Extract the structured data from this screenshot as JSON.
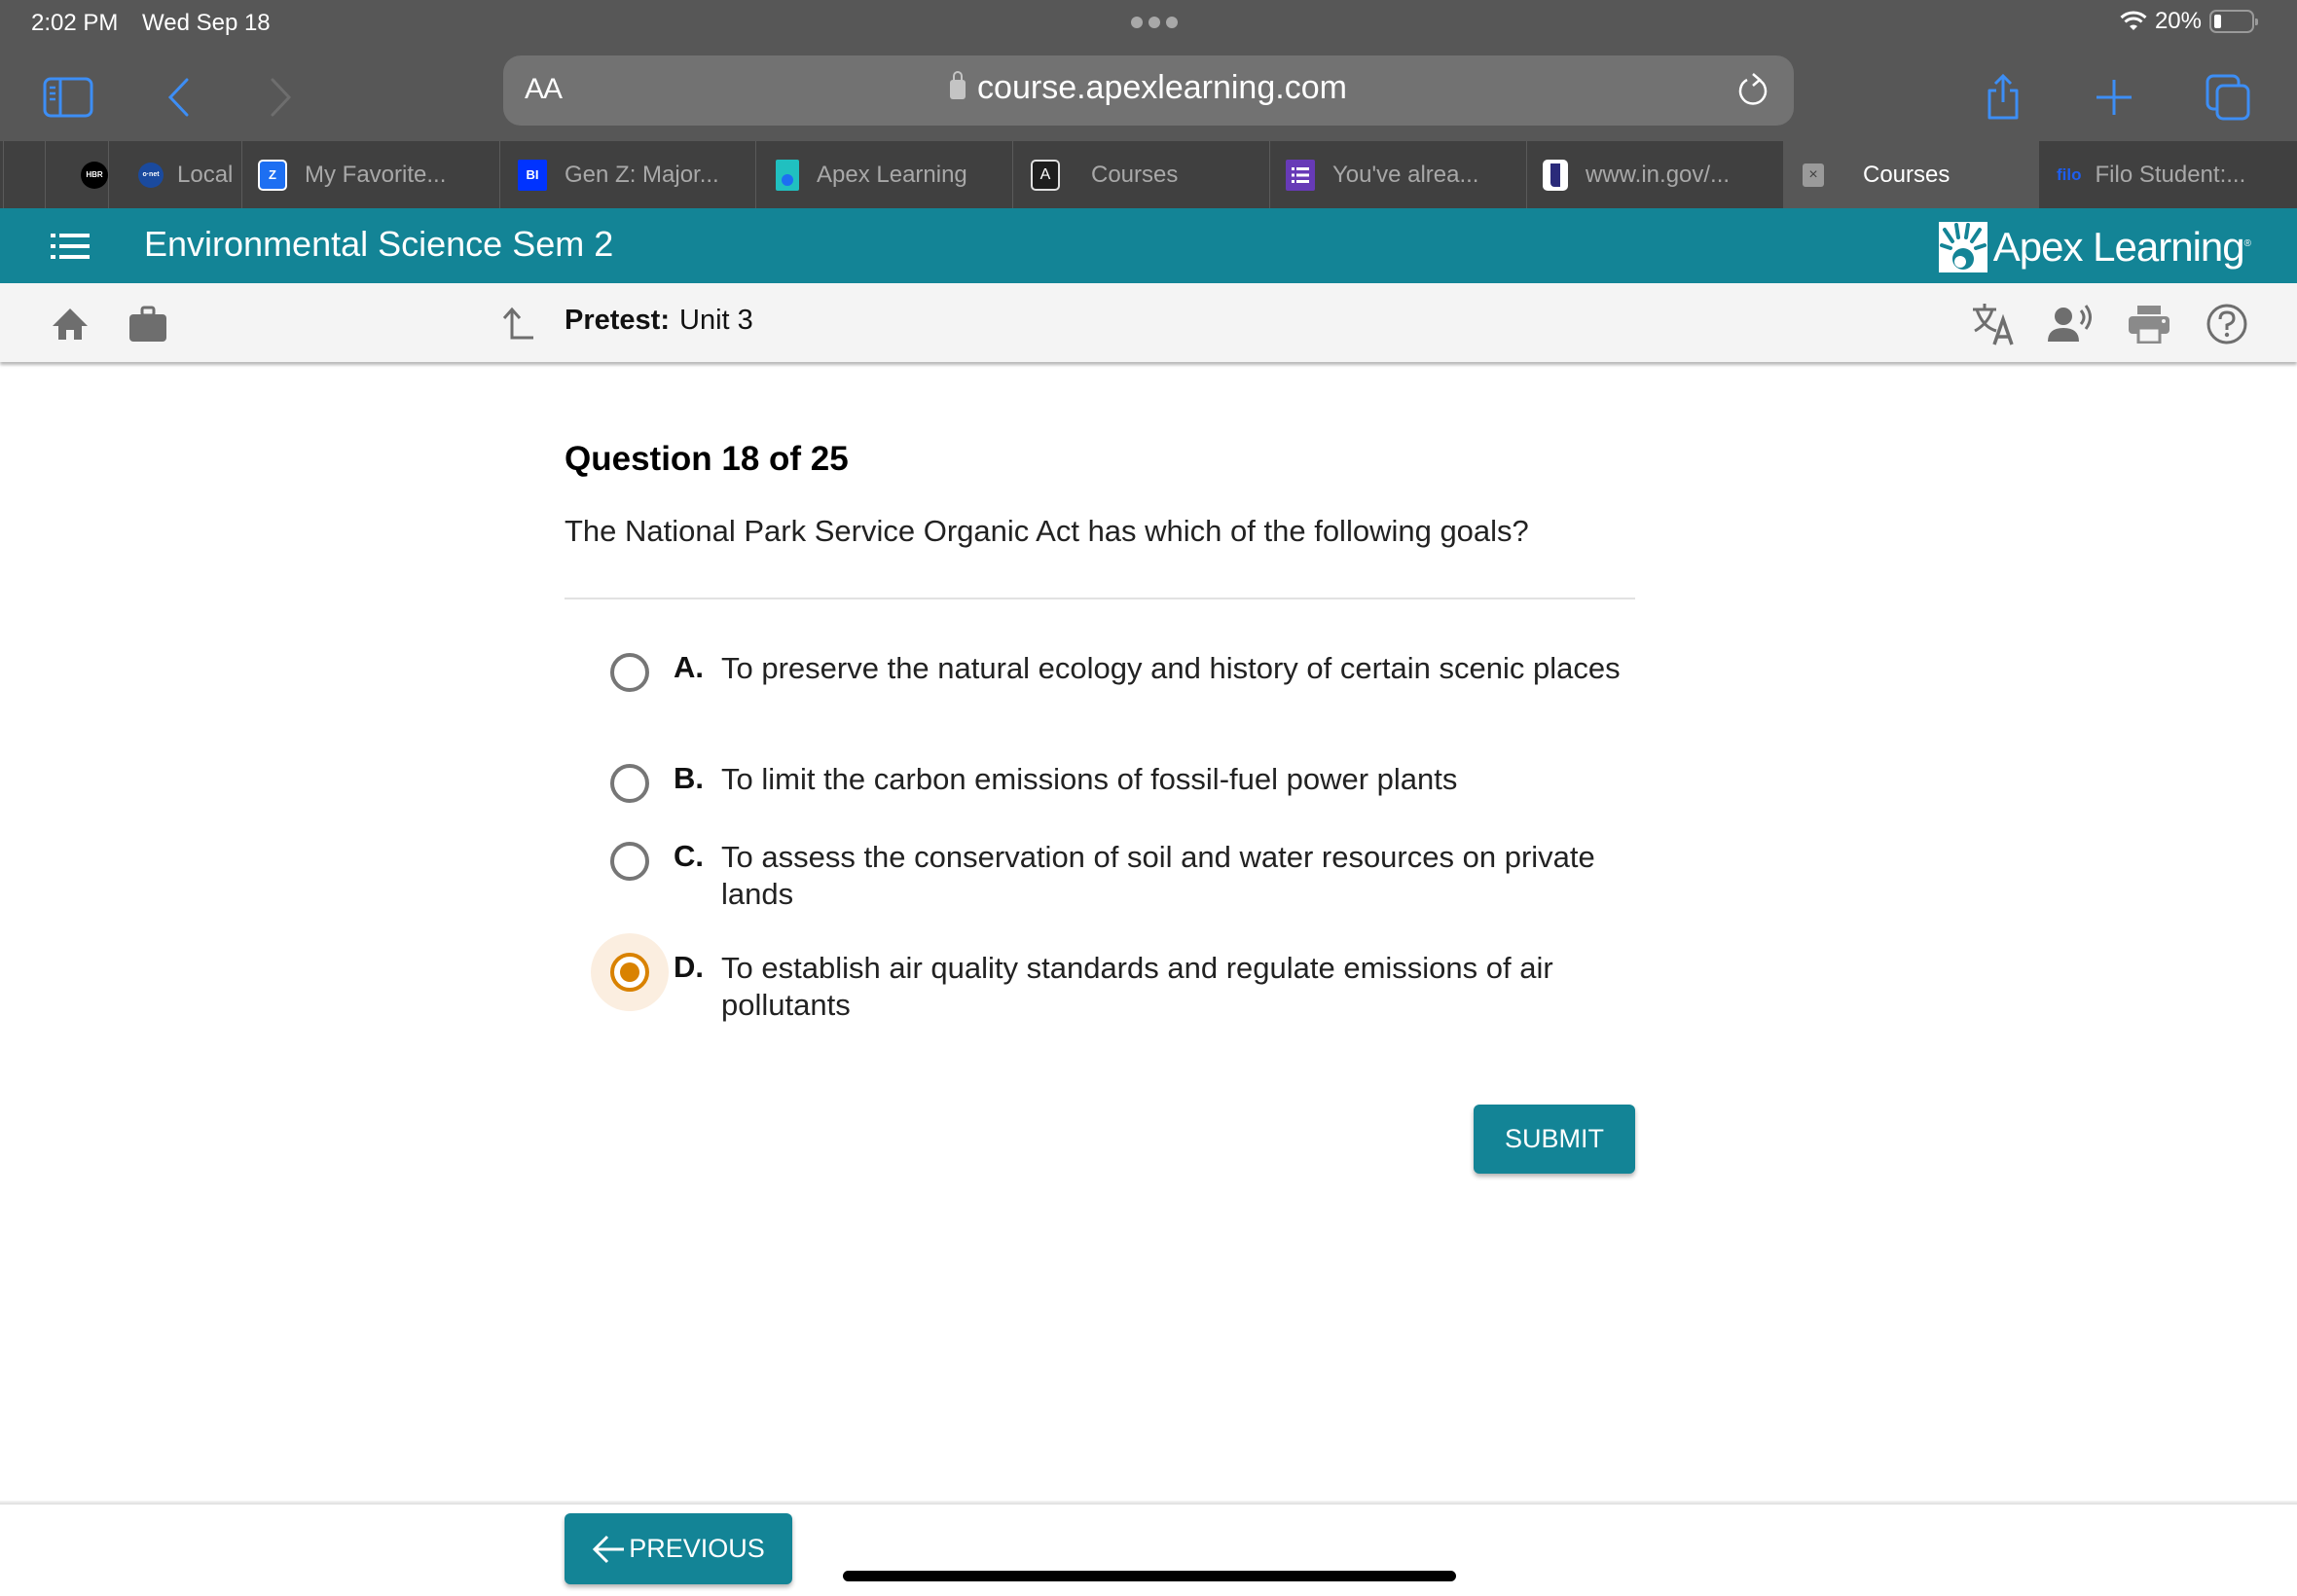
{
  "status_bar": {
    "time": "2:02 PM",
    "date": "Wed Sep 18",
    "battery_percent": "20%",
    "battery_level": 0.2
  },
  "browser": {
    "text_size_button": "AA",
    "url": "course.apexlearning.com",
    "accent_color": "#3d8ef5",
    "tabs": [
      {
        "label": "",
        "favicon": "blank"
      },
      {
        "label": "",
        "favicon": "hbr-icon"
      },
      {
        "label": "Local",
        "favicon": "onet-icon"
      },
      {
        "label": "My Favorite...",
        "favicon": "zillow-icon"
      },
      {
        "label": "Gen Z: Major...",
        "favicon": "bi-icon"
      },
      {
        "label": "Apex Learning",
        "favicon": "apex-icon"
      },
      {
        "label": "Courses",
        "favicon": "a-icon"
      },
      {
        "label": "You've alrea...",
        "favicon": "forms-icon"
      },
      {
        "label": "www.in.gov/...",
        "favicon": "indiana-icon"
      },
      {
        "label": "Courses",
        "favicon": "close-icon",
        "active": true
      },
      {
        "label": "Filo Student:...",
        "favicon": "filo-icon"
      }
    ]
  },
  "app": {
    "course_title": "Environmental Science Sem 2",
    "brand": "Apex Learning",
    "brand_color": "#138496",
    "breadcrumb": {
      "label": "Pretest:",
      "value": "Unit 3"
    }
  },
  "question": {
    "header": "Question 18 of 25",
    "current": 18,
    "total": 25,
    "prompt": "The National Park Service Organic Act has which of the following goals?",
    "options": [
      {
        "letter": "A.",
        "text": "To preserve the natural ecology and history of certain scenic places",
        "selected": false
      },
      {
        "letter": "B.",
        "text": "To limit the carbon emissions of fossil-fuel power plants",
        "selected": false
      },
      {
        "letter": "C.",
        "text": "To assess the conservation of soil and water resources on private lands",
        "selected": false
      },
      {
        "letter": "D.",
        "text": "To establish air quality standards and regulate emissions of air pollutants",
        "selected": true
      }
    ],
    "selected_color": "#d98200"
  },
  "buttons": {
    "submit": "SUBMIT",
    "previous": "PREVIOUS"
  }
}
